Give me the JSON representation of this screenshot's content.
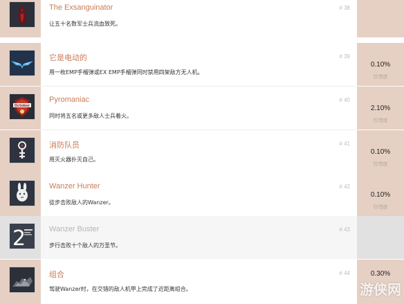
{
  "achievements": [
    {
      "title": "The Exsanguinator",
      "description": "让五十名数军士兵流血致死。",
      "number": "# 38",
      "percent": "",
      "rarity": "",
      "icon": "blood-drop-icon",
      "locked": false
    },
    {
      "title": "它是电动的",
      "description": "用一枚EMP手榴弹或EX EMP手榴弹同时禁用四架敌方无人机。",
      "number": "# 39",
      "percent": "0.10%",
      "rarity": "珍惜度",
      "icon": "emp-wings-icon",
      "locked": false
    },
    {
      "title": "Pyromaniac",
      "description": "同时将五名或更多敌人士兵着火。",
      "number": "# 40",
      "percent": "2.10%",
      "rarity": "珍惜度",
      "icon": "october-badge-icon",
      "locked": false
    },
    {
      "title": "消防队员",
      "description": "用灭火器扑灭自己。",
      "number": "# 41",
      "percent": "0.10%",
      "rarity": "珍惜度",
      "icon": "firefighter-icon",
      "locked": false
    },
    {
      "title": "Wanzer Hunter",
      "description": "徒步击败敌人的Wanzer。",
      "number": "# 42",
      "percent": "0.10%",
      "rarity": "珍惜度",
      "icon": "rabbit-icon",
      "locked": false
    },
    {
      "title": "Wanzer Buster",
      "description": "步行击败十个敌人的万圣节。",
      "number": "# 43",
      "percent": "",
      "rarity": "",
      "icon": "number-two-icon",
      "locked": true
    },
    {
      "title": "组合",
      "description": "驾驶Wanzer时，在交错的敌人机甲上完成了近距离组合。",
      "number": "# 44",
      "percent": "0.30%",
      "rarity": "",
      "icon": "mech-combo-icon",
      "locked": false
    }
  ],
  "watermark": "游侠网",
  "colors": {
    "accent_title": "#c97b56",
    "side_panel": "#e6d0c4",
    "locked_panel": "#e1e1e1"
  }
}
